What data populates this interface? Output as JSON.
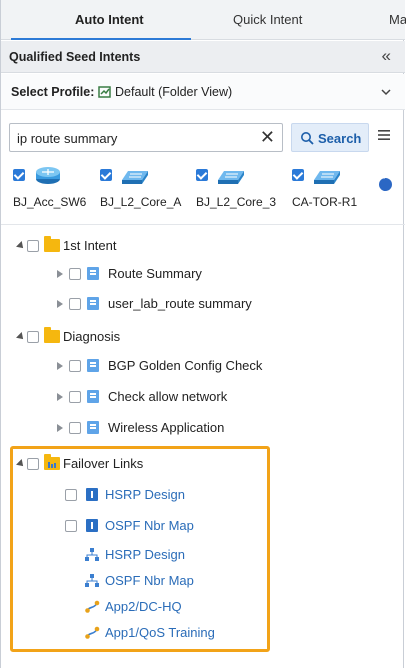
{
  "tabs": [
    {
      "label": "Auto Intent",
      "active": true
    },
    {
      "label": "Quick Intent",
      "active": false
    },
    {
      "label": "Ma",
      "active": false
    }
  ],
  "panel": {
    "title": "Qualified Seed Intents",
    "collapse_glyph": "«"
  },
  "profile": {
    "label": "Select Profile:",
    "value": "Default (Folder View)"
  },
  "search": {
    "value": "ip route summary",
    "clear_glyph": "✕",
    "button_label": "Search"
  },
  "devices": [
    {
      "name": "BJ_Acc_SW6",
      "icon": "router-icon"
    },
    {
      "name": "BJ_L2_Core_A",
      "icon": "switch-icon"
    },
    {
      "name": "BJ_L2_Core_3",
      "icon": "switch-icon"
    },
    {
      "name": "CA-TOR-R1",
      "icon": "switch-icon"
    }
  ],
  "tree": {
    "intent1": {
      "label": "1st Intent",
      "children": [
        "Route Summary",
        "user_lab_route summary"
      ]
    },
    "diagnosis": {
      "label": "Diagnosis",
      "children": [
        "BGP Golden Config Check",
        "Check allow network",
        "Wireless Application"
      ]
    },
    "failover": {
      "label": "Failover Links",
      "children": [
        "HSRP Design",
        "OSPF Nbr Map",
        "HSRP Design",
        "OSPF Nbr Map",
        "App2/DC-HQ",
        "App1/QoS Training"
      ]
    }
  },
  "colors": {
    "accent": "#2d7ad6",
    "folder": "#f5b70f",
    "highlight": "#f2a318",
    "link": "#2a6cb8"
  }
}
